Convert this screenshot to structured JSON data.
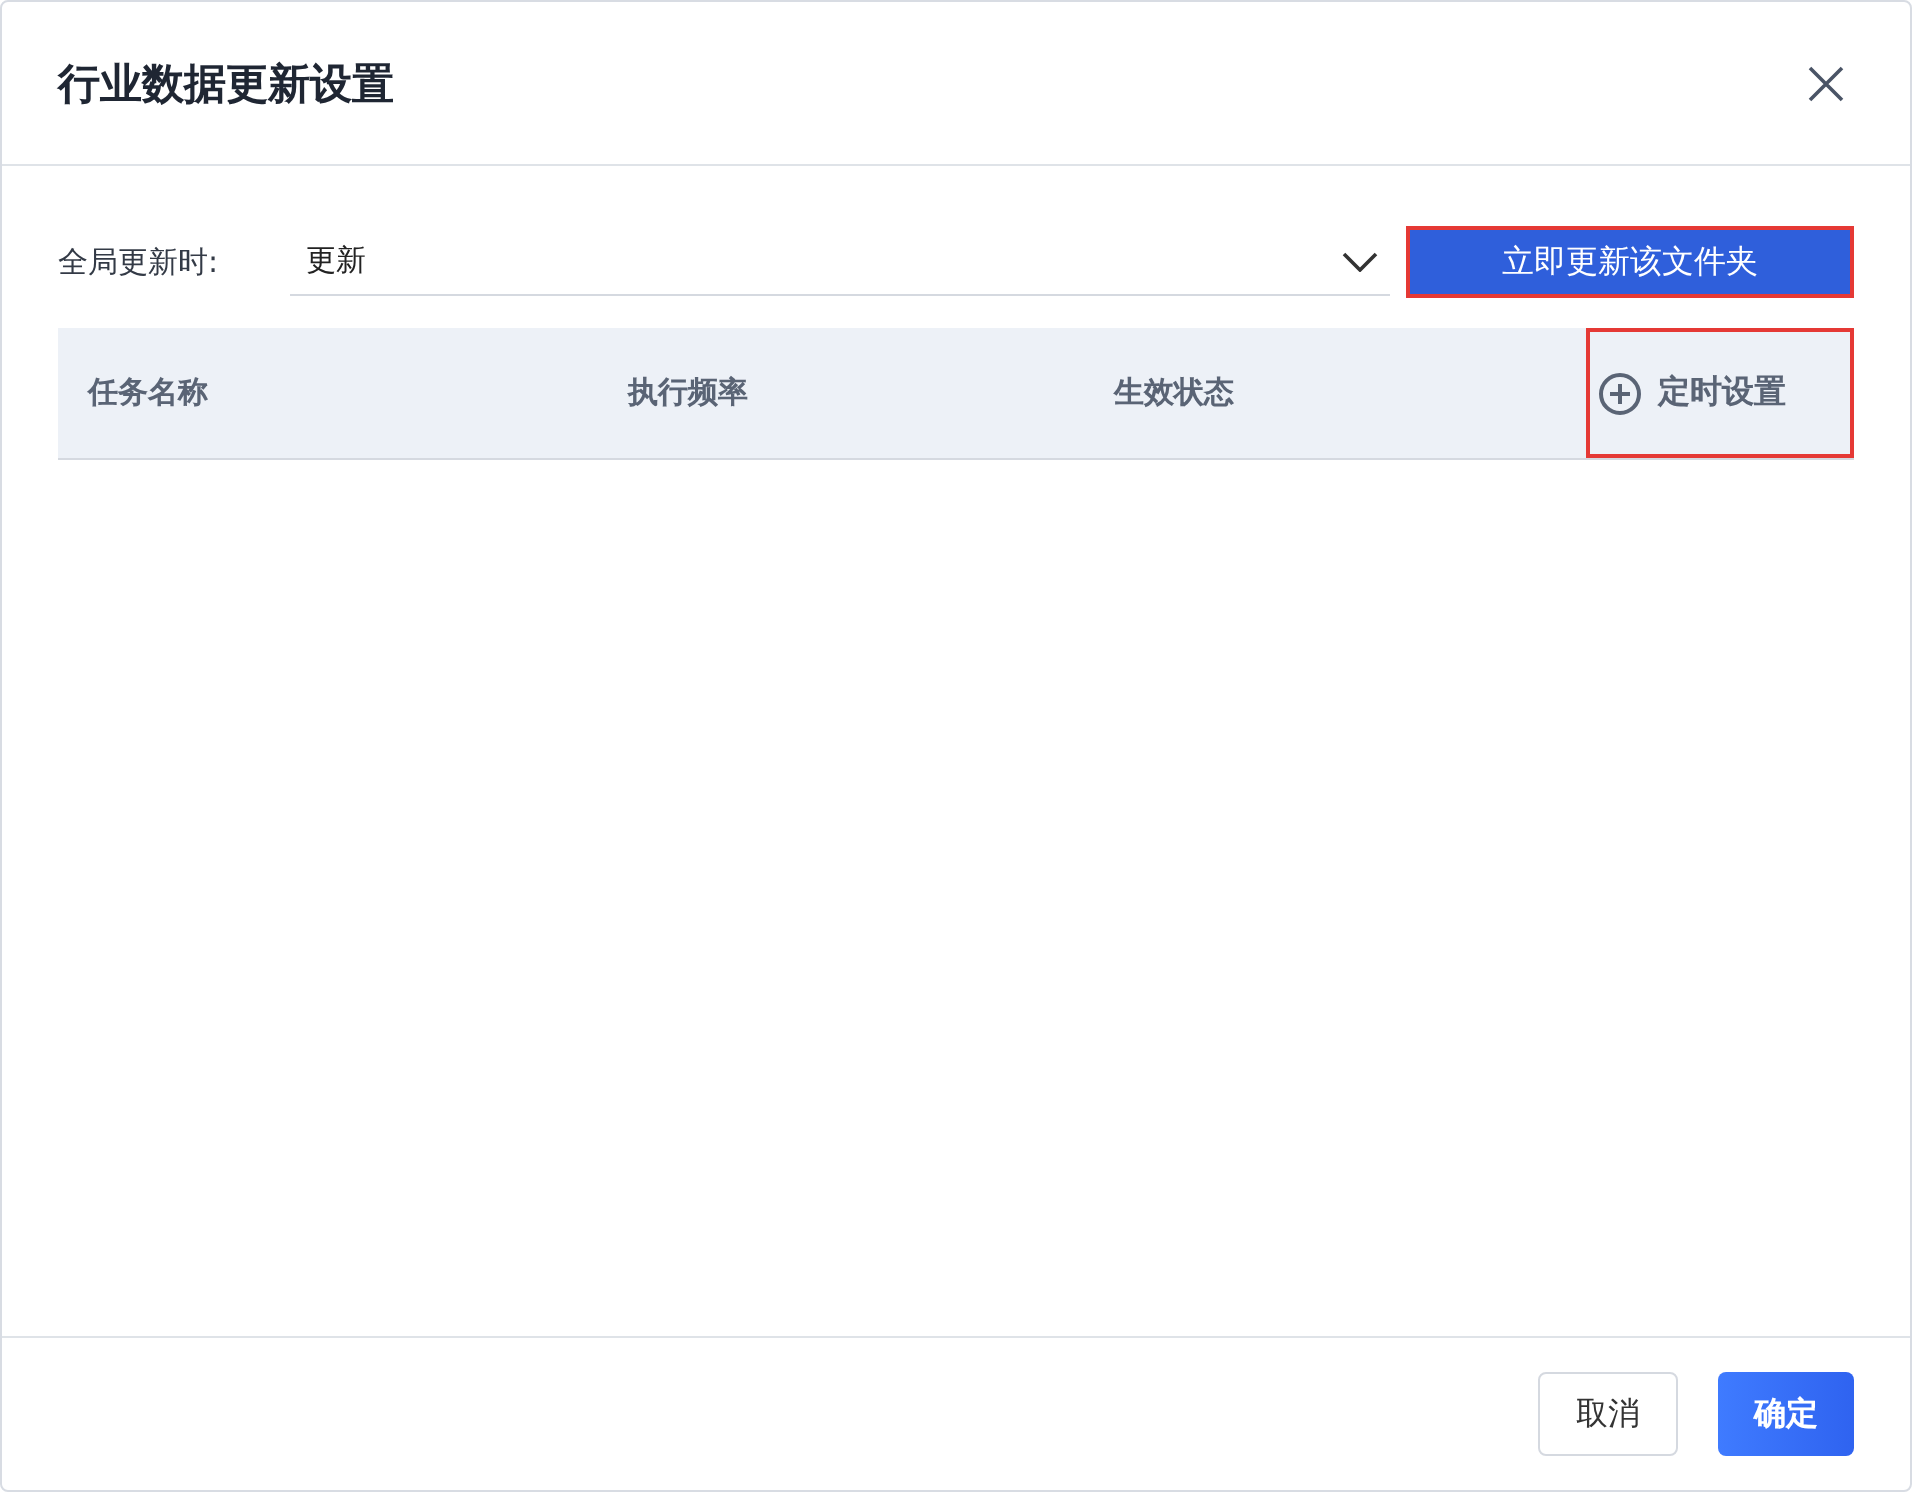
{
  "dialog": {
    "title": "行业数据更新设置"
  },
  "global_update": {
    "label": "全局更新时:",
    "value": "更新"
  },
  "update_now_button": {
    "label": "立即更新该文件夹",
    "highlighted": true
  },
  "table": {
    "columns": [
      {
        "label": "任务名称"
      },
      {
        "label": "执行频率"
      },
      {
        "label": "生效状态"
      }
    ],
    "add_schedule": {
      "label": "定时设置",
      "highlighted": true
    }
  },
  "footer": {
    "buttons": [
      {
        "label": "取消",
        "kind": "secondary"
      },
      {
        "label": "确定",
        "kind": "primary"
      }
    ]
  }
}
